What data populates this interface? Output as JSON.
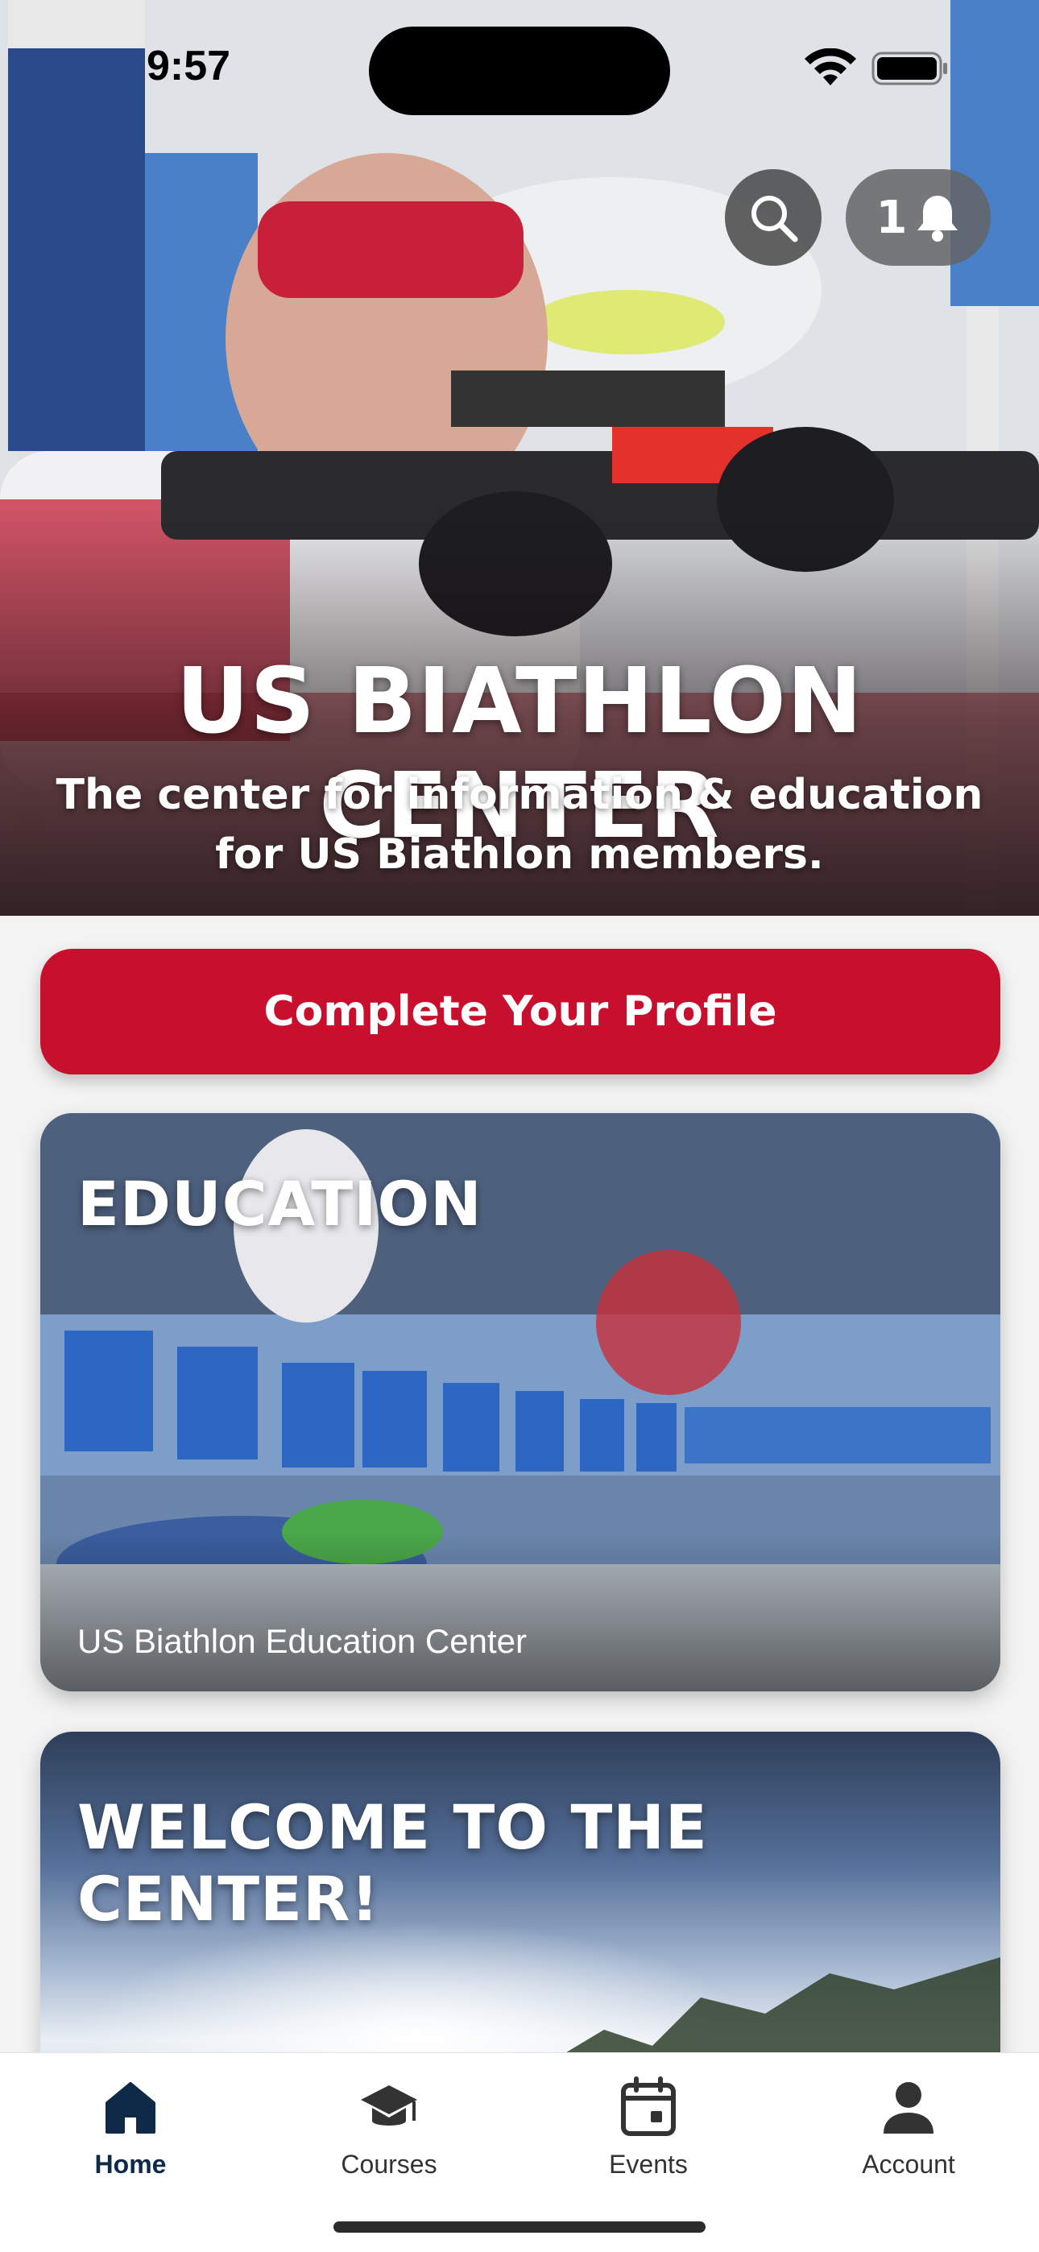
{
  "status_bar": {
    "time": "9:57"
  },
  "header": {
    "notification_count": "1",
    "search_icon": "search-icon",
    "notification_icon": "bell-icon"
  },
  "hero": {
    "title": "US BIATHLON CENTER",
    "subtitle": "The center for information & education for US Biathlon members."
  },
  "cta": {
    "label": "Complete Your Profile"
  },
  "cards": [
    {
      "title": "EDUCATION",
      "caption": "US Biathlon Education Center"
    },
    {
      "title": "WELCOME TO THE CENTER!"
    }
  ],
  "tab_bar": {
    "items": [
      {
        "label": "Home",
        "icon": "home-icon",
        "active": true
      },
      {
        "label": "Courses",
        "icon": "graduation-cap-icon",
        "active": false
      },
      {
        "label": "Events",
        "icon": "calendar-icon",
        "active": false
      },
      {
        "label": "Account",
        "icon": "person-icon",
        "active": false
      }
    ]
  },
  "colors": {
    "brand_red": "#c8102e",
    "brand_navy": "#0e2a47"
  }
}
